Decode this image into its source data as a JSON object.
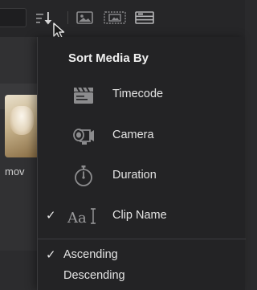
{
  "toolbar": {
    "sort_icon": "sort-down-icon",
    "view_icons": [
      "thumbnail-view-icon",
      "filmstrip-view-icon",
      "list-view-icon"
    ]
  },
  "background": {
    "clip_filename_fragment": "mov"
  },
  "menu": {
    "title": "Sort Media By",
    "sort_options": [
      {
        "label": "Timecode",
        "icon": "clapperboard-icon",
        "checked": false
      },
      {
        "label": "Camera",
        "icon": "camera-icon",
        "checked": false
      },
      {
        "label": "Duration",
        "icon": "stopwatch-icon",
        "checked": false
      },
      {
        "label": "Clip Name",
        "icon": "text-cursor-icon",
        "icon_text": "Aa",
        "checked": true
      }
    ],
    "order_options": [
      {
        "label": "Ascending",
        "checked": true
      },
      {
        "label": "Descending",
        "checked": false
      }
    ],
    "check_glyph": "✓"
  },
  "colors": {
    "menu_bg": "#232325",
    "icon_gray": "#8c8c8e",
    "text": "#e4e4e4"
  }
}
